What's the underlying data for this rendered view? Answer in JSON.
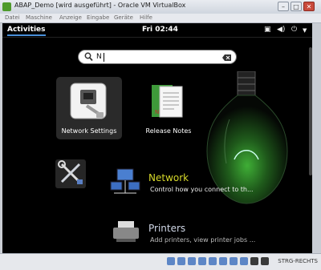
{
  "window": {
    "title": "ABAP_Demo [wird ausgeführt] - Oracle VM VirtualBox",
    "menu": [
      "Datei",
      "Maschine",
      "Anzeige",
      "Eingabe",
      "Geräte",
      "Hilfe"
    ]
  },
  "topbar": {
    "activities": "Activities",
    "clock": "Fri 02:44"
  },
  "search": {
    "value": "N"
  },
  "apps": [
    {
      "label": "Network Settings"
    },
    {
      "label": "Release Notes"
    }
  ],
  "settings_results": [
    {
      "title": "Network",
      "subtitle": "Control how you connect to th...",
      "color": "#d6d82a"
    },
    {
      "title": "Printers",
      "subtitle": "Add printers, view printer jobs ...",
      "color": "#cfd6e6"
    }
  ],
  "statusbar": {
    "host_key": "STRG-RECHTS"
  },
  "colors": {
    "activities_underline": "#4a90d9",
    "bulb_glow": "#2f7d2a"
  }
}
